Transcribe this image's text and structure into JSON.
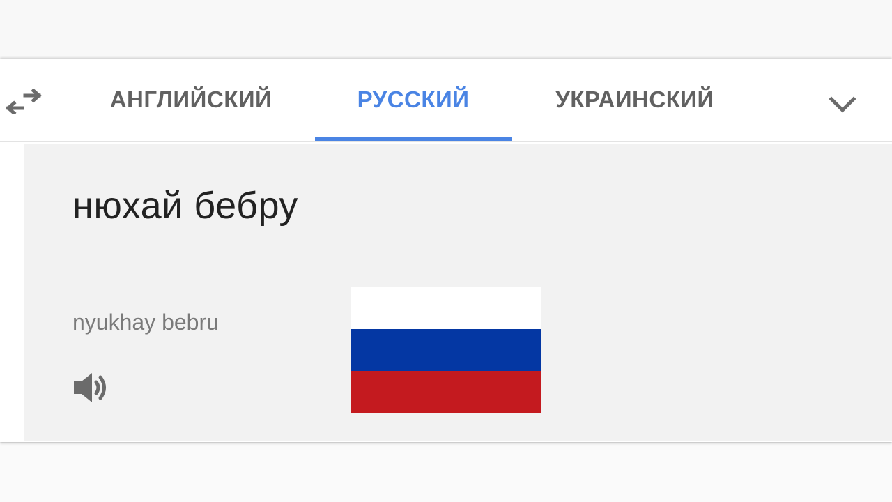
{
  "languages": {
    "tabs": [
      {
        "label": "АНГЛИЙСКИЙ",
        "active": false
      },
      {
        "label": "РУССКИЙ",
        "active": true
      },
      {
        "label": "УКРАИНСКИЙ",
        "active": false
      }
    ],
    "swap_icon": "swap-arrows-icon",
    "more_icon": "chevron-down-icon"
  },
  "result": {
    "translation": "нюхай бебру",
    "transliteration": "nyukhay bebru",
    "speaker_icon": "speaker-icon"
  },
  "flag": {
    "icon": "russia-flag",
    "stripes": [
      "#ffffff",
      "#0437a3",
      "#c41a1f"
    ]
  },
  "colors": {
    "accent": "#4a84e4",
    "tab_inactive": "#616161",
    "panel_bg": "#f2f2f2"
  }
}
